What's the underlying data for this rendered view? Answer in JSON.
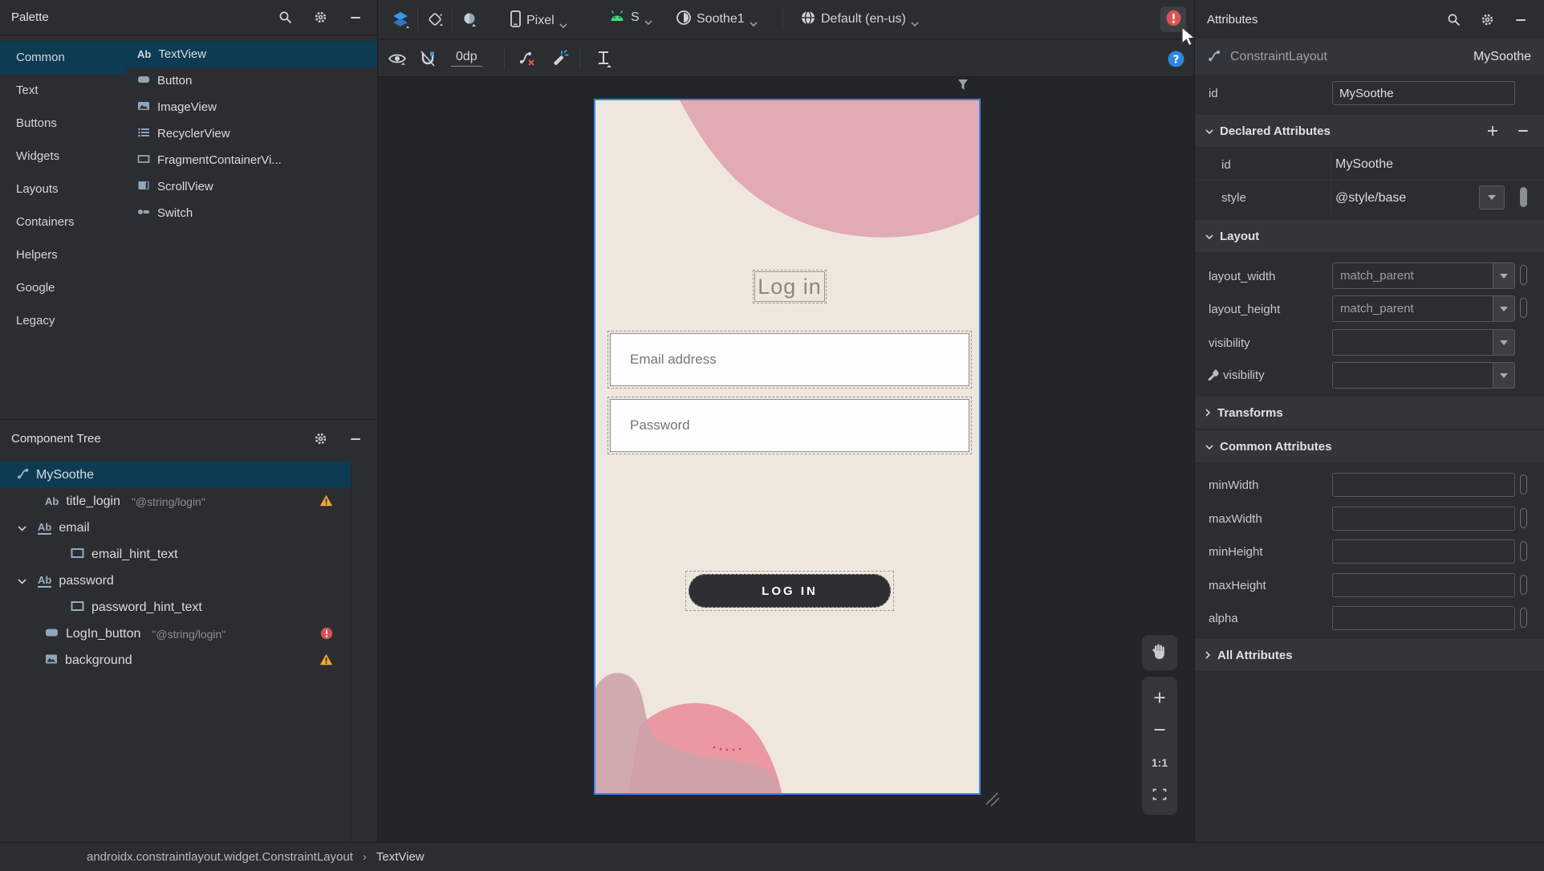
{
  "palette": {
    "title": "Palette",
    "categories": [
      {
        "label": "Common"
      },
      {
        "label": "Text"
      },
      {
        "label": "Buttons"
      },
      {
        "label": "Widgets"
      },
      {
        "label": "Layouts"
      },
      {
        "label": "Containers"
      },
      {
        "label": "Helpers"
      },
      {
        "label": "Google"
      },
      {
        "label": "Legacy"
      }
    ],
    "items": [
      {
        "label": "TextView"
      },
      {
        "label": "Button"
      },
      {
        "label": "ImageView"
      },
      {
        "label": "RecyclerView"
      },
      {
        "label": "FragmentContainerVi..."
      },
      {
        "label": "ScrollView"
      },
      {
        "label": "Switch"
      }
    ]
  },
  "tree": {
    "title": "Component Tree",
    "rows": [
      {
        "label": "MySoothe"
      },
      {
        "label": "title_login",
        "value": "\"@string/login\""
      },
      {
        "label": "email"
      },
      {
        "label": "email_hint_text"
      },
      {
        "label": "password"
      },
      {
        "label": "password_hint_text"
      },
      {
        "label": "LogIn_button",
        "value": "\"@string/login\""
      },
      {
        "label": "background"
      }
    ]
  },
  "toolbar": {
    "device_label": "Pixel",
    "api_label": "S",
    "theme_label": "Soothe1",
    "locale_label": "Default (en-us)",
    "margin_label": "0dp"
  },
  "canvas": {
    "login_title": "Log in",
    "email_placeholder": "Email address",
    "password_placeholder": "Password",
    "login_button": "LOG IN",
    "zoom_one": "1:1"
  },
  "attributes": {
    "title": "Attributes",
    "component_type": "ConstraintLayout",
    "component_id": "MySoothe",
    "id_label": "id",
    "id_value": "MySoothe",
    "declared": {
      "title": "Declared Attributes",
      "rows": [
        {
          "name": "id",
          "value": "MySoothe"
        },
        {
          "name": "style",
          "value": "@style/base"
        }
      ]
    },
    "layout": {
      "title": "Layout",
      "width_label": "layout_width",
      "width_value": "match_parent",
      "height_label": "layout_height",
      "height_value": "match_parent",
      "visibility_label": "visibility",
      "tools_visibility_label": "visibility"
    },
    "transforms_title": "Transforms",
    "common": {
      "title": "Common Attributes",
      "rows": [
        "minWidth",
        "maxWidth",
        "minHeight",
        "maxHeight",
        "alpha"
      ]
    },
    "all_title": "All Attributes"
  },
  "statusbar": {
    "path": "androidx.constraintlayout.widget.ConstraintLayout",
    "sep": "›",
    "current": "TextView"
  },
  "colors": {
    "accent_blue": "#3b83f2",
    "android_green": "#3ddc84",
    "error_red": "#d8555a",
    "warning_orange": "#f0a732",
    "selection": "#0d3b54",
    "device_beige": "#efe7de",
    "blob_pink": "#e2aab3",
    "blob_salmon": "#ec98a2",
    "blob_mauve": "#cda2aa"
  }
}
